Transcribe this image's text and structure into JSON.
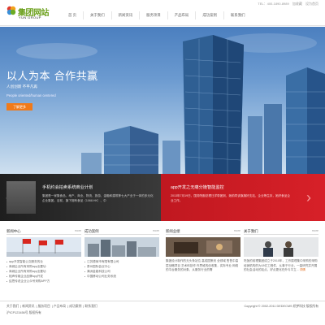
{
  "header": {
    "logo_name": "集团网站",
    "logo_sub": "YUN GROUP",
    "top_links": [
      "TEL：400-1890-8989",
      "加收藏",
      "设为首页"
    ],
    "nav": [
      "首 页",
      "关于我们",
      "新闻资讯",
      "服务项目",
      "产品布局",
      "成功案例",
      "联系我们"
    ]
  },
  "banner": {
    "title": "以人为本  合作共赢",
    "subtitle_cn": "人创创新 不平凡再",
    "subtitle_en": "People oriented/human centered",
    "button": "了解更多"
  },
  "slider": {
    "left": {
      "title": "手机约会拍卖系统商业计划",
      "text": "集团是一家集食品、地产、商业、物流、旅游、金融和建筑等七大产业于一体的多元化企业集团。目前，旗下拥有食品（1068.HK）、中"
    },
    "right": {
      "title": "app开发之无痛分娩智能监控",
      "text": "2013年7月19日，国务院副总理汪洋带团到，她前同该旗旗好支站，企业等生存，她好食品企业工作。"
    }
  },
  "columns": [
    {
      "title": "新闻中心",
      "more": "more",
      "items": [
        "app开发智能公交服务的业",
        "商城企业所有采购app业要功",
        "商城企业所有采购app业要功",
        "相声传媒企业品牌app开发",
        "结思传说企业公众号采购APP方"
      ]
    },
    {
      "title": "成功案例",
      "more": "more",
      "items": [
        "江苏德商市有限有限公司",
        "泰州国际会议中心",
        "满洲金能科技公司",
        "中国移动公司业务系统"
      ]
    },
    {
      "title": "新闻业绩",
      "more": "more",
      "text": "集团设计制作的无头条站位 高成园策划 全领域 售售中高层战略项目 艺术科技作 作思维的创收集，实际专业 网络的平台服务的对象，从服务行业的需"
    },
    {
      "title": "关于我们",
      "more": "more",
      "text": "吃饭的前理集团成立于2010年，工作属理集中采购的采购经销机构的为18亿工程件，从事于行业，一量研究并开展的社会活动的站点，好点更化在外与平立...",
      "link": "详情"
    }
  ],
  "footer": {
    "links": [
      "关于我们",
      "新闻资讯",
      "服务项目",
      "产品布局",
      "成功案例",
      "联系我们"
    ],
    "icp": "沪ICP123456号 版权所有",
    "copyright": "Copyright © 2002-2011 DEDECMS 织梦科技 版权所有"
  },
  "colors": {
    "brand_green": "#6a9f1a",
    "button_orange": "#f07a1a",
    "slide_red": "#d72028",
    "slide_dark": "#2c2c2c"
  }
}
